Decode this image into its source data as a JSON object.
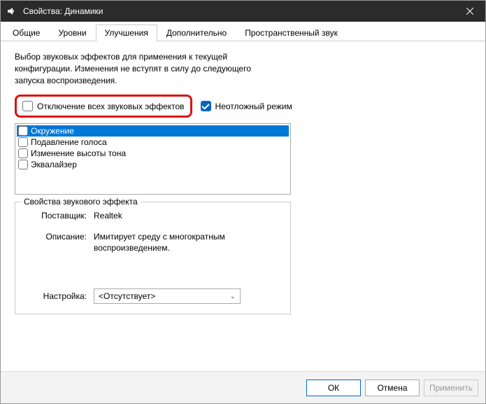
{
  "window": {
    "title": "Свойства: Динамики"
  },
  "tabs": {
    "general": "Общие",
    "levels": "Уровни",
    "enhancements": "Улучшения",
    "advanced": "Дополнительно",
    "spatial": "Пространственный звук"
  },
  "intro": "Выбор звуковых эффектов для применения к текущей конфигурации. Изменения не вступят в силу до следующего запуска воспроизведения.",
  "toggles": {
    "disable_all_label": "Отключение всех звуковых эффектов",
    "immediate_label": "Неотложный режим"
  },
  "effects": [
    {
      "label": "Окружение",
      "selected": true
    },
    {
      "label": "Подавление голоса",
      "selected": false
    },
    {
      "label": "Изменение высоты тона",
      "selected": false
    },
    {
      "label": "Эквалайзер",
      "selected": false
    }
  ],
  "props": {
    "group_title": "Свойства звукового эффекта",
    "provider_label": "Поставщик:",
    "provider_value": "Realtek",
    "description_label": "Описание:",
    "description_value": "Имитирует среду с многократным воспроизведением.",
    "setting_label": "Настройка:",
    "setting_value": "<Отсутствует>"
  },
  "buttons": {
    "ok": "ОК",
    "cancel": "Отмена",
    "apply": "Применить"
  }
}
